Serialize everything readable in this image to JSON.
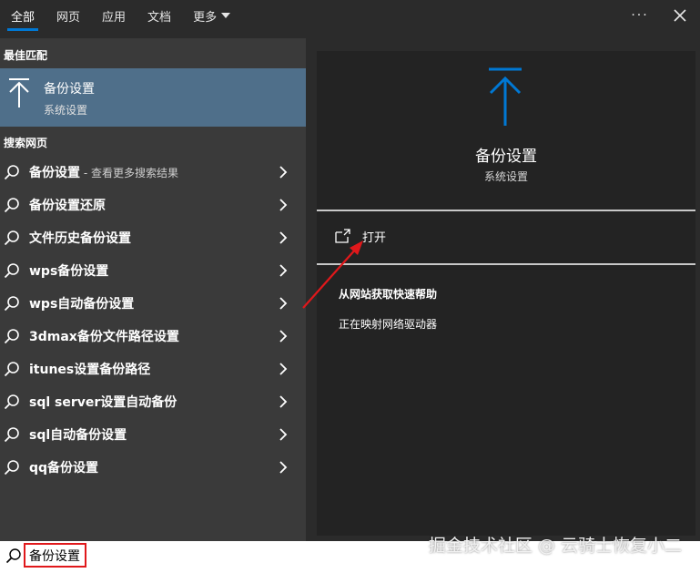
{
  "tabs": [
    {
      "label": "全部",
      "active": true
    },
    {
      "label": "网页",
      "active": false
    },
    {
      "label": "应用",
      "active": false
    },
    {
      "label": "文档",
      "active": false
    },
    {
      "label": "更多",
      "active": false
    }
  ],
  "top_actions": {
    "more": "···",
    "close": "✕"
  },
  "best_match": {
    "section_label": "最佳匹配",
    "title": "备份设置",
    "subtitle": "系统设置",
    "icon": "backup-arrow-up-icon"
  },
  "web_search": {
    "section_label": "搜索网页",
    "results": [
      {
        "text": "备份设置",
        "suffix": " - 查看更多搜索结果"
      },
      {
        "text": "备份设置还原",
        "suffix": ""
      },
      {
        "text": "文件历史备份设置",
        "suffix": ""
      },
      {
        "text": "wps备份设置",
        "suffix": ""
      },
      {
        "text": "wps自动备份设置",
        "suffix": ""
      },
      {
        "text": "3dmax备份文件路径设置",
        "suffix": ""
      },
      {
        "text": "itunes设置备份路径",
        "suffix": ""
      },
      {
        "text": "sql server设置自动备份",
        "suffix": ""
      },
      {
        "text": "sql自动备份设置",
        "suffix": ""
      },
      {
        "text": "qq备份设置",
        "suffix": ""
      }
    ]
  },
  "preview": {
    "title": "备份设置",
    "subtitle": "系统设置",
    "open_label": "打开",
    "help_title": "从网站获取快速帮助",
    "help_link": "正在映射网络驱动器"
  },
  "search": {
    "value": "备份设置"
  },
  "watermark": "掘金技术社区 @ 云骑士恢复小二",
  "colors": {
    "accent": "#0078d4",
    "selected": "#4f6f8a",
    "annotation": "#e0181b"
  }
}
